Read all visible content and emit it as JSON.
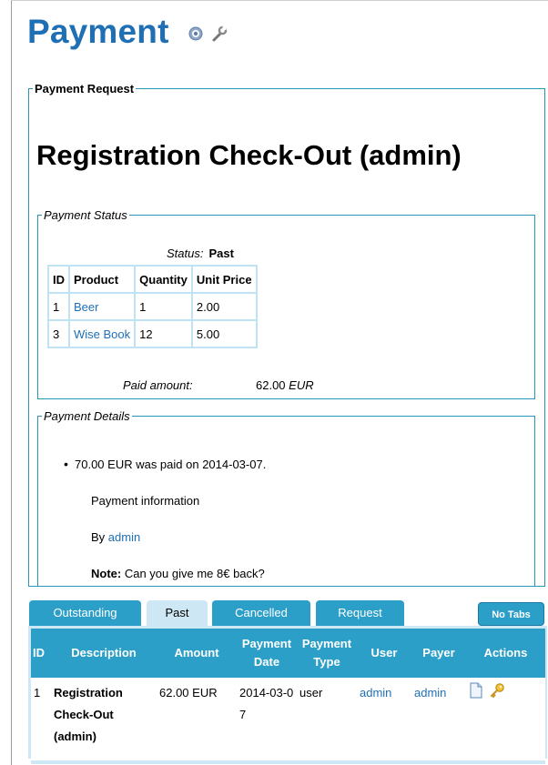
{
  "page": {
    "title": "Payment",
    "icons": [
      "help-icon",
      "wrench-icon"
    ]
  },
  "request": {
    "legend": "Payment Request",
    "title": "Registration Check-Out (admin)",
    "status": {
      "legend": "Payment Status",
      "status_label": "Status:",
      "status_value": "Past",
      "columns": [
        "ID",
        "Product",
        "Quantity",
        "Unit Price"
      ],
      "rows": [
        {
          "id": "1",
          "product": "Beer",
          "quantity": "1",
          "unit_price": "2.00"
        },
        {
          "id": "3",
          "product": "Wise Book",
          "quantity": "12",
          "unit_price": "5.00"
        }
      ],
      "paid_label": "Paid amount:",
      "paid_value": "62.00",
      "paid_currency": "EUR"
    },
    "details": {
      "legend": "Payment Details",
      "paid_line": "70.00 EUR was paid on 2014-03-07.",
      "info": "Payment information",
      "by_label": "By",
      "by_user": "admin",
      "note_label": "Note:",
      "note_text": "Can you give me 8€ back?"
    }
  },
  "tabs": {
    "items": [
      {
        "label": "Outstanding",
        "active": false
      },
      {
        "label": "Past",
        "active": true
      },
      {
        "label": "Cancelled",
        "active": false
      },
      {
        "label": "Request",
        "active": false
      }
    ],
    "no_tabs": "No Tabs"
  },
  "payments_table": {
    "columns": [
      "ID",
      "Description",
      "Amount",
      "Payment Date",
      "Payment Type",
      "User",
      "Payer",
      "Actions"
    ],
    "rows": [
      {
        "id": "1",
        "description": "Registration Check-Out (admin)",
        "amount": "62.00 EUR",
        "date": "2014-03-07",
        "type": "user",
        "user": "admin",
        "payer": "admin",
        "actions": [
          "view-icon",
          "key-icon"
        ]
      }
    ]
  },
  "colors": {
    "title": "#1f6fb5",
    "tab": "#2c9fc9",
    "tab_active": "#cde8f4",
    "fieldset_border": "#2b95b5",
    "link": "#1f6fb5"
  }
}
